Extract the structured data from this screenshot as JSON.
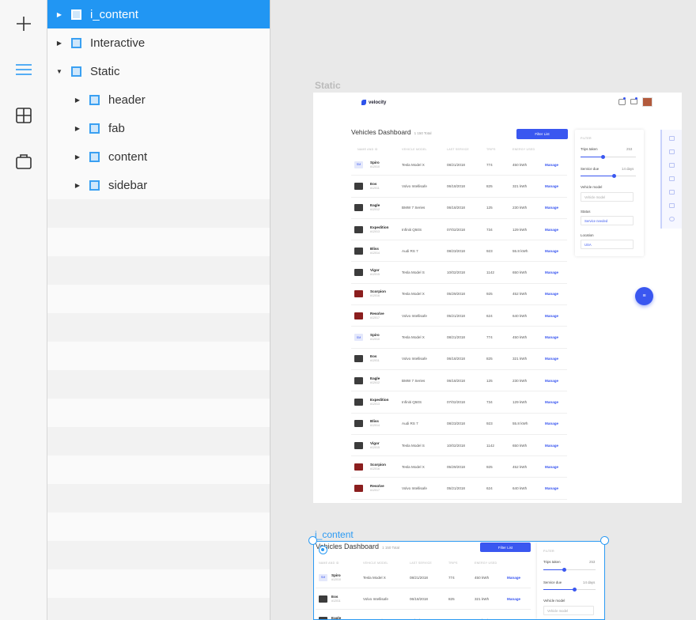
{
  "rail": {
    "items": [
      {
        "icon": "plus-icon"
      },
      {
        "icon": "layers-icon",
        "active": true
      },
      {
        "icon": "grid-icon"
      },
      {
        "icon": "briefcase-icon"
      }
    ]
  },
  "layers": [
    {
      "label": "i_content",
      "selected": true,
      "expanded": false,
      "level": 0
    },
    {
      "label": "Interactive",
      "expanded": false,
      "level": 0
    },
    {
      "label": "Static",
      "expanded": true,
      "level": 0
    },
    {
      "label": "header",
      "level": 1
    },
    {
      "label": "fab",
      "level": 1
    },
    {
      "label": "content",
      "level": 1
    },
    {
      "label": "sidebar",
      "level": 1
    }
  ],
  "artboards": {
    "static_label": "Static",
    "icontent_label": "i_content"
  },
  "app": {
    "brand": "velocity",
    "title": "Vehicles Dashboard",
    "subtitle": "1 150 Total",
    "filter_button": "Filter List",
    "columns": [
      "NAME AND ID",
      "VEHICLE MODEL",
      "LAST SERVICE",
      "TRIPS",
      "ENERGY USED"
    ],
    "rows": [
      {
        "name": "Spiro",
        "id": "#12010",
        "model": "Tesla Model X",
        "date": "08/21/2018",
        "trips": "774",
        "energy": "450 kWh",
        "action": "Manage",
        "thumb": "SM"
      },
      {
        "name": "Eos",
        "id": "#12011",
        "model": "Volvo Intellisafe",
        "date": "06/18/2018",
        "trips": "825",
        "energy": "321 kWh",
        "action": "Manage",
        "thumb": ""
      },
      {
        "name": "Eagle",
        "id": "#12012",
        "model": "BMW 7 Series",
        "date": "06/18/2018",
        "trips": "125",
        "energy": "230 kWh",
        "action": "Manage",
        "thumb": ""
      },
      {
        "name": "Expedition",
        "id": "#12013",
        "model": "Infiniti Q50S",
        "date": "07/02/2018",
        "trips": "734",
        "energy": "129 kWh",
        "action": "Manage",
        "thumb": ""
      },
      {
        "name": "Bliss",
        "id": "#12014",
        "model": "Audi RS 7",
        "date": "08/23/2018",
        "trips": "923",
        "energy": "55.8 kWh",
        "action": "Manage",
        "thumb": ""
      },
      {
        "name": "Vigor",
        "id": "#12015",
        "model": "Tesla Model S",
        "date": "10/02/2018",
        "trips": "1142",
        "energy": "650 kWh",
        "action": "Manage",
        "thumb": ""
      },
      {
        "name": "Scorpion",
        "id": "#12016",
        "model": "Tesla Model X",
        "date": "05/29/2018",
        "trips": "925",
        "energy": "452 kWh",
        "action": "Manage",
        "thumb": "red"
      },
      {
        "name": "Resolve",
        "id": "#12017",
        "model": "Volvo Intellisafe",
        "date": "05/21/2018",
        "trips": "624",
        "energy": "640 kWh",
        "action": "Manage",
        "thumb": "red"
      },
      {
        "name": "Spiro",
        "id": "#12010",
        "model": "Tesla Model X",
        "date": "08/21/2018",
        "trips": "774",
        "energy": "450 kWh",
        "action": "Manage",
        "thumb": "SM"
      },
      {
        "name": "Eos",
        "id": "#12011",
        "model": "Volvo Intellisafe",
        "date": "06/18/2018",
        "trips": "825",
        "energy": "321 kWh",
        "action": "Manage",
        "thumb": ""
      },
      {
        "name": "Eagle",
        "id": "#12012",
        "model": "BMW 7 Series",
        "date": "06/18/2018",
        "trips": "125",
        "energy": "230 kWh",
        "action": "Manage",
        "thumb": ""
      },
      {
        "name": "Expedition",
        "id": "#12013",
        "model": "Infiniti Q50S",
        "date": "07/02/2018",
        "trips": "734",
        "energy": "129 kWh",
        "action": "Manage",
        "thumb": ""
      },
      {
        "name": "Bliss",
        "id": "#12014",
        "model": "Audi RS 7",
        "date": "08/23/2018",
        "trips": "923",
        "energy": "55.8 kWh",
        "action": "Manage",
        "thumb": ""
      },
      {
        "name": "Vigor",
        "id": "#12015",
        "model": "Tesla Model S",
        "date": "10/02/2018",
        "trips": "1142",
        "energy": "650 kWh",
        "action": "Manage",
        "thumb": ""
      },
      {
        "name": "Scorpion",
        "id": "#12016",
        "model": "Tesla Model X",
        "date": "05/29/2018",
        "trips": "925",
        "energy": "452 kWh",
        "action": "Manage",
        "thumb": "red"
      },
      {
        "name": "Resolve",
        "id": "#12017",
        "model": "Volvo Intellisafe",
        "date": "05/21/2018",
        "trips": "624",
        "energy": "640 kWh",
        "action": "Manage",
        "thumb": "red"
      }
    ],
    "filter": {
      "heading": "FILTER",
      "trips_label": "Trips taken",
      "trips_value": "253",
      "trips_fraction": 0.4,
      "service_label": "Service due",
      "service_value": "14 days",
      "service_fraction": 0.6,
      "model_label": "Vehicle model",
      "model_placeholder": "Vehicle model",
      "status_label": "Status",
      "status_value": "Service needed",
      "location_label": "Location",
      "location_value": "USA"
    }
  },
  "colors": {
    "accent": "#3a57f0",
    "selection": "#2196f3"
  }
}
